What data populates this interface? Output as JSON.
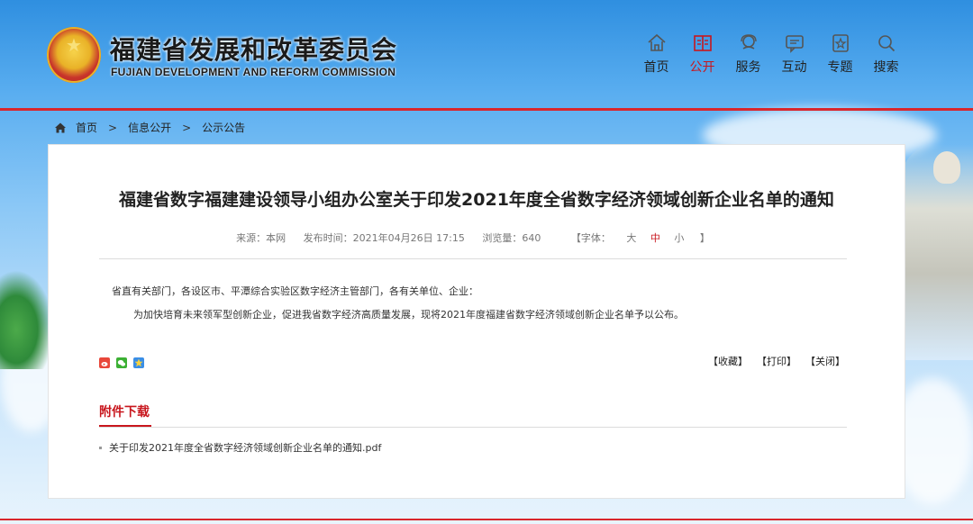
{
  "header": {
    "title_cn": "福建省发展和改革委员会",
    "title_en": "FUJIAN DEVELOPMENT AND REFORM COMMISSION"
  },
  "nav": {
    "items": [
      {
        "label": "首页",
        "icon": "home-icon"
      },
      {
        "label": "公开",
        "icon": "book-icon",
        "active": true
      },
      {
        "label": "服务",
        "icon": "service-icon"
      },
      {
        "label": "互动",
        "icon": "chat-icon"
      },
      {
        "label": "专题",
        "icon": "topic-icon"
      },
      {
        "label": "搜索",
        "icon": "search-icon"
      }
    ]
  },
  "breadcrumb": {
    "items": [
      "首页",
      "信息公开",
      "公示公告"
    ],
    "separator": ">"
  },
  "article": {
    "title": "福建省数字福建建设领导小组办公室关于印发2021年度全省数字经济领域创新企业名单的通知",
    "source": "来源：本网",
    "publish_time": "发布时间：2021年04月26日 17:15",
    "views": "浏览量：640",
    "font_label": "【字体：",
    "font_large": "大",
    "font_medium": "中",
    "font_small": "小",
    "font_close": "】",
    "paragraph1": "省直有关部门，各设区市、平潭综合实验区数字经济主管部门，各有关单位、企业：",
    "paragraph2": "为加快培育未来领军型创新企业，促进我省数字经济高质量发展，现将2021年度福建省数字经济领域创新企业名单予以公布。"
  },
  "actions": {
    "collect": "【收藏】",
    "print": "【打印】",
    "close": "【关闭】"
  },
  "attachments": {
    "title": "附件下载",
    "items": [
      "关于印发2021年度全省数字经济领域创新企业名单的通知.pdf"
    ]
  },
  "colors": {
    "accent_red": "#c8161d",
    "header_bar": "#d9262c"
  }
}
